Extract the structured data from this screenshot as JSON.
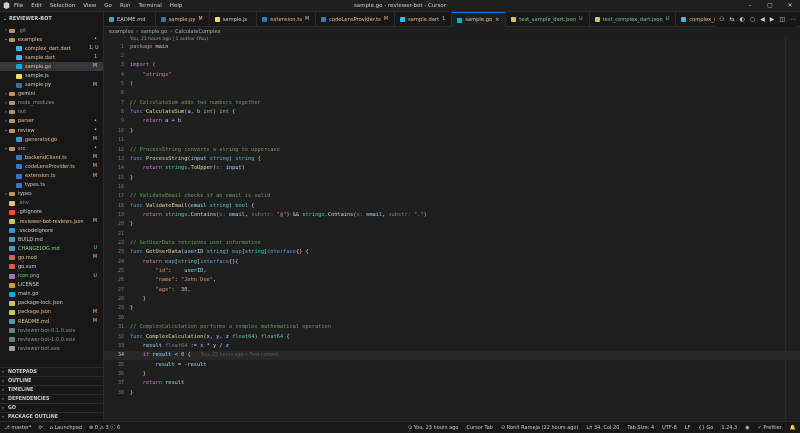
{
  "window": {
    "title": "sample.go - reviewer-bot - Cursor",
    "menu": [
      "File",
      "Edit",
      "Selection",
      "View",
      "Go",
      "Run",
      "Terminal",
      "Help"
    ],
    "controls": [
      "–",
      "▢",
      "✕"
    ]
  },
  "explorer": {
    "root": "REVIEWER-BOT",
    "items": [
      {
        "label": ".git",
        "depth": 0,
        "chev": "›",
        "icon": "folder",
        "badge": "",
        "color": "#8c8c8c"
      },
      {
        "label": "examples",
        "depth": 0,
        "chev": "⌄",
        "icon": "folder",
        "badge": "",
        "color": "#e2c08d",
        "badgeDot": true
      },
      {
        "label": "complex_dart.dart",
        "depth": 1,
        "chev": "",
        "icon": "dart",
        "badge": "1, U",
        "color": "#e2c08d"
      },
      {
        "label": "sample.dart",
        "depth": 1,
        "chev": "",
        "icon": "dart",
        "badge": "1",
        "color": "#e2c08d"
      },
      {
        "label": "sample.go",
        "depth": 1,
        "chev": "",
        "icon": "go",
        "badge": "M",
        "color": "#e2c08d",
        "selected": true
      },
      {
        "label": "sample.js",
        "depth": 1,
        "chev": "",
        "icon": "js",
        "badge": "",
        "color": "#cccccc"
      },
      {
        "label": "sample.py",
        "depth": 1,
        "chev": "",
        "icon": "py",
        "badge": "M",
        "color": "#e2c08d"
      },
      {
        "label": "gemini",
        "depth": 0,
        "chev": "›",
        "icon": "folder",
        "badge": "",
        "color": "#cccccc"
      },
      {
        "label": "node_modules",
        "depth": 0,
        "chev": "›",
        "icon": "folder",
        "badge": "",
        "color": "#8c8c8c"
      },
      {
        "label": "out",
        "depth": 0,
        "chev": "›",
        "icon": "folder",
        "badge": "",
        "color": "#8c8c8c"
      },
      {
        "label": "parser",
        "depth": 0,
        "chev": "›",
        "icon": "folder",
        "badge": "",
        "color": "#e2c08d",
        "badgeDot": true
      },
      {
        "label": "review",
        "depth": 0,
        "chev": "⌄",
        "icon": "folder",
        "badge": "",
        "color": "#e2c08d",
        "badgeDot": true
      },
      {
        "label": "generator.go",
        "depth": 1,
        "chev": "",
        "icon": "go",
        "badge": "M",
        "color": "#e2c08d"
      },
      {
        "label": "src",
        "depth": 0,
        "chev": "⌄",
        "icon": "folder",
        "badge": "",
        "color": "#e2c08d",
        "badgeDot": true
      },
      {
        "label": "backendClient.ts",
        "depth": 1,
        "chev": "",
        "icon": "ts",
        "badge": "M",
        "color": "#e2c08d"
      },
      {
        "label": "codeLensProvider.ts",
        "depth": 1,
        "chev": "",
        "icon": "ts",
        "badge": "M",
        "color": "#e2c08d"
      },
      {
        "label": "extension.ts",
        "depth": 1,
        "chev": "",
        "icon": "ts",
        "badge": "M",
        "color": "#e2c08d"
      },
      {
        "label": "types.ts",
        "depth": 1,
        "chev": "",
        "icon": "ts",
        "badge": "",
        "color": "#cccccc"
      },
      {
        "label": "types",
        "depth": 0,
        "chev": "›",
        "icon": "folder",
        "badge": "",
        "color": "#cccccc"
      },
      {
        "label": ".env",
        "depth": 0,
        "chev": "",
        "icon": "env",
        "badge": "",
        "color": "#8c8c8c"
      },
      {
        "label": ".gitignore",
        "depth": 0,
        "chev": "",
        "icon": "git",
        "badge": "",
        "color": "#cccccc"
      },
      {
        "label": ".reviewer-bot-reviews.json",
        "depth": 0,
        "chev": "",
        "icon": "json",
        "badge": "M",
        "color": "#e2c08d"
      },
      {
        "label": ".vscodeignore",
        "depth": 0,
        "chev": "",
        "icon": "vsc",
        "badge": "",
        "color": "#cccccc"
      },
      {
        "label": "BUILD.md",
        "depth": 0,
        "chev": "",
        "icon": "md",
        "badge": "",
        "color": "#cccccc"
      },
      {
        "label": "CHANGELOG.md",
        "depth": 0,
        "chev": "",
        "icon": "md",
        "badge": "U",
        "color": "#73c991"
      },
      {
        "label": "go.mod",
        "depth": 0,
        "chev": "",
        "icon": "gomod",
        "badge": "M",
        "color": "#e2c08d"
      },
      {
        "label": "go.sum",
        "depth": 0,
        "chev": "",
        "icon": "gomod",
        "badge": "",
        "color": "#cccccc"
      },
      {
        "label": "icon.png",
        "depth": 0,
        "chev": "",
        "icon": "png",
        "badge": "U",
        "color": "#73c991"
      },
      {
        "label": "LICENSE",
        "depth": 0,
        "chev": "",
        "icon": "license",
        "badge": "",
        "color": "#cccccc"
      },
      {
        "label": "main.go",
        "depth": 0,
        "chev": "",
        "icon": "go",
        "badge": "",
        "color": "#cccccc"
      },
      {
        "label": "package-lock.json",
        "depth": 0,
        "chev": "",
        "icon": "json",
        "badge": "",
        "color": "#cccccc"
      },
      {
        "label": "package.json",
        "depth": 0,
        "chev": "",
        "icon": "json",
        "badge": "M",
        "color": "#e2c08d"
      },
      {
        "label": "README.md",
        "depth": 0,
        "chev": "",
        "icon": "md",
        "badge": "M",
        "color": "#e2c08d"
      },
      {
        "label": "reviewer-bot-0.1.0.vsix",
        "depth": 0,
        "chev": "",
        "icon": "vsix",
        "badge": "",
        "color": "#8c8c8c"
      },
      {
        "label": "reviewer-bot-1.0.0.vsix",
        "depth": 0,
        "chev": "",
        "icon": "vsix",
        "badge": "",
        "color": "#8c8c8c"
      },
      {
        "label": "reviewer-bot.exe",
        "depth": 0,
        "chev": "",
        "icon": "exe",
        "badge": "",
        "color": "#8c8c8c"
      }
    ],
    "sections": [
      "NOTEPADS",
      "OUTLINE",
      "TIMELINE",
      "DEPENDENCIES",
      "GO",
      "PACKAGE OUTLINE"
    ]
  },
  "tabs": [
    {
      "label": "EADME.md",
      "badge": "",
      "icon": "md",
      "color": "#cccccc"
    },
    {
      "label": "sample.py",
      "badge": "M",
      "icon": "py",
      "color": "#e2c08d"
    },
    {
      "label": "sample.js",
      "badge": "",
      "icon": "js",
      "color": "#cccccc"
    },
    {
      "label": "extension.ts",
      "badge": "M",
      "icon": "ts",
      "color": "#e2c08d"
    },
    {
      "label": "codeLensProvider.ts",
      "badge": "M",
      "icon": "ts",
      "color": "#e2c08d"
    },
    {
      "label": "sample.dart",
      "badge": "1",
      "icon": "dart",
      "color": "#e2c08d"
    },
    {
      "label": "sample.go",
      "badge": "M",
      "icon": "go",
      "color": "#e2c08d",
      "active": true
    },
    {
      "label": "test_sample_dart.json",
      "badge": "U",
      "icon": "json",
      "color": "#73c991"
    },
    {
      "label": "test_complex_dart.json",
      "badge": "U",
      "icon": "json",
      "color": "#73c991"
    },
    {
      "label": "complex_d",
      "badge": "",
      "icon": "dart",
      "color": "#e2c08d"
    }
  ],
  "tab_actions": [
    "⚇",
    "⇆",
    "◐",
    "○",
    "◀",
    "▶",
    "◫",
    "⋯"
  ],
  "breadcrumb": [
    "examples",
    "›",
    "sample.go",
    "›",
    "CalculateComplex"
  ],
  "codelens": "You, 23 hours ago | 1 author (You)",
  "editor": {
    "current_line": 34,
    "blame": "You, 23 hours ago • First commit",
    "lines": [
      [
        [
          "kw",
          "package "
        ],
        [
          "pun",
          "main"
        ]
      ],
      [],
      [
        [
          "kw",
          "import "
        ],
        [
          "pun",
          "("
        ]
      ],
      [
        [
          "pun",
          "    "
        ],
        [
          "str",
          "\"strings\""
        ]
      ],
      [
        [
          "pun",
          ")"
        ]
      ],
      [],
      [
        [
          "cmt",
          "// CalculateSum adds two numbers together"
        ]
      ],
      [
        [
          "kw2",
          "func "
        ],
        [
          "fn",
          "CalculateSum"
        ],
        [
          "pun",
          "("
        ],
        [
          "var",
          "a"
        ],
        [
          "pun",
          ", "
        ],
        [
          "var",
          "b "
        ],
        [
          "typ",
          "int"
        ],
        [
          "pun",
          ") "
        ],
        [
          "typ",
          "int"
        ],
        [
          "pun",
          " {"
        ]
      ],
      [
        [
          "pun",
          "    "
        ],
        [
          "kw",
          "return "
        ],
        [
          "var",
          "a "
        ],
        [
          "pun",
          "+ "
        ],
        [
          "var",
          "b"
        ]
      ],
      [
        [
          "pun",
          "}"
        ]
      ],
      [],
      [
        [
          "cmt",
          "// ProcessString converts a string to uppercase"
        ]
      ],
      [
        [
          "kw2",
          "func "
        ],
        [
          "fn",
          "ProcessString"
        ],
        [
          "pun",
          "("
        ],
        [
          "var",
          "input "
        ],
        [
          "typ",
          "string"
        ],
        [
          "pun",
          ") "
        ],
        [
          "typ",
          "string"
        ],
        [
          "pun",
          " {"
        ]
      ],
      [
        [
          "pun",
          "    "
        ],
        [
          "kw",
          "return "
        ],
        [
          "typ",
          "strings"
        ],
        [
          "pun",
          "."
        ],
        [
          "fn",
          "ToUpper"
        ],
        [
          "pun",
          "("
        ],
        [
          "hint",
          "s: "
        ],
        [
          "var",
          "input"
        ],
        [
          "pun",
          ")"
        ]
      ],
      [
        [
          "pun",
          "}"
        ]
      ],
      [],
      [
        [
          "cmt",
          "// ValidateEmail checks if an email is valid"
        ]
      ],
      [
        [
          "kw2",
          "func "
        ],
        [
          "fn",
          "ValidateEmail"
        ],
        [
          "pun",
          "("
        ],
        [
          "var",
          "email "
        ],
        [
          "typ",
          "string"
        ],
        [
          "pun",
          ") "
        ],
        [
          "typ",
          "bool"
        ],
        [
          "pun",
          " {"
        ]
      ],
      [
        [
          "pun",
          "    "
        ],
        [
          "kw",
          "return "
        ],
        [
          "typ",
          "strings"
        ],
        [
          "pun",
          "."
        ],
        [
          "fn",
          "Contains"
        ],
        [
          "pun",
          "("
        ],
        [
          "hint",
          "s: "
        ],
        [
          "var",
          "email"
        ],
        [
          "pun",
          ", "
        ],
        [
          "hint",
          "substr: "
        ],
        [
          "str",
          "\"@\""
        ],
        [
          "pun",
          ") && "
        ],
        [
          "typ",
          "strings"
        ],
        [
          "pun",
          "."
        ],
        [
          "fn",
          "Contains"
        ],
        [
          "pun",
          "("
        ],
        [
          "hint",
          "s: "
        ],
        [
          "var",
          "email"
        ],
        [
          "pun",
          ", "
        ],
        [
          "hint",
          "substr: "
        ],
        [
          "str",
          "\".\""
        ],
        [
          "pun",
          ")"
        ]
      ],
      [
        [
          "pun",
          "}"
        ]
      ],
      [],
      [
        [
          "cmt",
          "// GetUserData retrieves user information"
        ]
      ],
      [
        [
          "kw2",
          "func "
        ],
        [
          "fn",
          "GetUserData"
        ],
        [
          "pun",
          "("
        ],
        [
          "var",
          "userID "
        ],
        [
          "typ",
          "string"
        ],
        [
          "pun",
          ") "
        ],
        [
          "kw2",
          "map"
        ],
        [
          "pun",
          "["
        ],
        [
          "typ",
          "string"
        ],
        [
          "pun",
          "]"
        ],
        [
          "kw2",
          "interface"
        ],
        [
          "pun",
          "{} {"
        ]
      ],
      [
        [
          "pun",
          "    "
        ],
        [
          "kw",
          "return "
        ],
        [
          "kw2",
          "map"
        ],
        [
          "pun",
          "["
        ],
        [
          "typ",
          "string"
        ],
        [
          "pun",
          "]"
        ],
        [
          "kw2",
          "interface"
        ],
        [
          "pun",
          "{}{"
        ]
      ],
      [
        [
          "pun",
          "        "
        ],
        [
          "str",
          "\"id\""
        ],
        [
          "pun",
          ":    "
        ],
        [
          "var",
          "userID"
        ],
        [
          "pun",
          ","
        ]
      ],
      [
        [
          "pun",
          "        "
        ],
        [
          "str",
          "\"name\""
        ],
        [
          "pun",
          ": "
        ],
        [
          "str",
          "\"John Doe\""
        ],
        [
          "pun",
          ","
        ]
      ],
      [
        [
          "pun",
          "        "
        ],
        [
          "str",
          "\"age\""
        ],
        [
          "pun",
          ":  "
        ],
        [
          "numv",
          "30"
        ],
        [
          "pun",
          ","
        ]
      ],
      [
        [
          "pun",
          "    }"
        ]
      ],
      [
        [
          "pun",
          "}"
        ]
      ],
      [],
      [
        [
          "cmt",
          "// ComplexCalculation performs a complex mathematical operation"
        ]
      ],
      [
        [
          "kw2",
          "func "
        ],
        [
          "fn",
          "ComplexCalculation"
        ],
        [
          "pun",
          "("
        ],
        [
          "var",
          "x"
        ],
        [
          "pun",
          ", "
        ],
        [
          "var",
          "y"
        ],
        [
          "pun",
          ", "
        ],
        [
          "var",
          "z "
        ],
        [
          "typ",
          "float64"
        ],
        [
          "pun",
          ") "
        ],
        [
          "typ",
          "float64"
        ],
        [
          "pun",
          " {"
        ]
      ],
      [
        [
          "pun",
          "    "
        ],
        [
          "var",
          "result "
        ],
        [
          "hint",
          "float64 "
        ],
        [
          "pun",
          ":= "
        ],
        [
          "var",
          "x "
        ],
        [
          "pun",
          "* "
        ],
        [
          "var",
          "y "
        ],
        [
          "pun",
          "/ "
        ],
        [
          "var",
          "z"
        ]
      ],
      [
        [
          "pun",
          "    "
        ],
        [
          "kw",
          "if "
        ],
        [
          "var",
          "result "
        ],
        [
          "pun",
          "< "
        ],
        [
          "numv",
          "0"
        ],
        [
          "pun",
          " {"
        ]
      ],
      [
        [
          "pun",
          "        "
        ],
        [
          "var",
          "result "
        ],
        [
          "pun",
          "= -"
        ],
        [
          "var",
          "result"
        ]
      ],
      [
        [
          "pun",
          "    }"
        ]
      ],
      [
        [
          "pun",
          "    "
        ],
        [
          "kw",
          "return "
        ],
        [
          "var",
          "result"
        ]
      ],
      [
        [
          "pun",
          "}"
        ]
      ]
    ]
  },
  "status": {
    "left": [
      "⎇ master*",
      "⟳",
      "⌂ Launchpad",
      "⊗ 0 ⚠ 3 ⓘ 6"
    ],
    "right": [
      "⊙ You, 23 hours ago",
      "Cursor Tab",
      "⊙ Ronit Rameja (22 hours ago)",
      "Ln 34, Col 20",
      "Tab Size: 4",
      "UTF-8",
      "LF",
      "{} Go",
      "1.24.3",
      "◉",
      "✓ Prettier",
      "🔔"
    ]
  }
}
